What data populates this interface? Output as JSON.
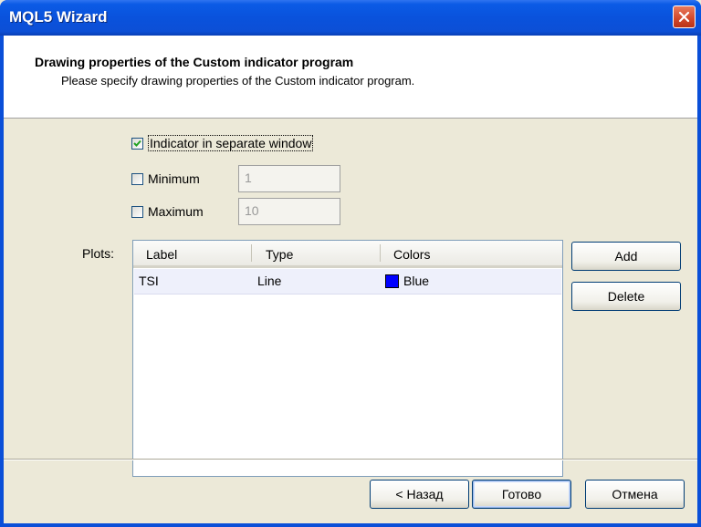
{
  "window": {
    "title": "MQL5 Wizard"
  },
  "header": {
    "title": "Drawing properties of the Custom indicator program",
    "subtitle": "Please specify drawing properties of the Custom indicator program."
  },
  "options": {
    "separate_window": {
      "label": "Indicator in separate window",
      "checked": true
    },
    "minimum": {
      "label": "Minimum",
      "checked": false,
      "value": "1"
    },
    "maximum": {
      "label": "Maximum",
      "checked": false,
      "value": "10"
    }
  },
  "plots": {
    "label": "Plots:",
    "columns": [
      "Label",
      "Type",
      "Colors"
    ],
    "rows": [
      {
        "label": "TSI",
        "type": "Line",
        "color_name": "Blue",
        "color": "#0000ff"
      }
    ],
    "add_label": "Add",
    "delete_label": "Delete"
  },
  "footer": {
    "back_label": "< Назад",
    "finish_label": "Готово",
    "cancel_label": "Отмена"
  },
  "colors": {
    "titlebar": "#0a52dc",
    "close": "#d2472a",
    "dialog_bg": "#ece9d8"
  }
}
